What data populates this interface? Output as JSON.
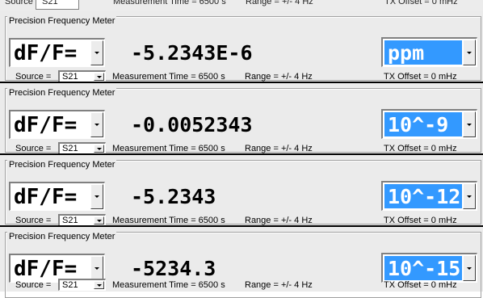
{
  "top_strip": {
    "source_label": "Source =",
    "source_value": "S21",
    "measurement_time": "Measurement Time = 6500 s",
    "range": "Range = +/- 4 Hz",
    "tx_offset": "TX Offset = 0 mHz"
  },
  "panels": [
    {
      "title": "Precision Frequency Meter",
      "mode": "dF/F=",
      "reading": "-5.2343E-6",
      "unit": "ppm",
      "source_label": "Source =",
      "source_value": "S21",
      "measurement_time": "Measurement Time = 6500 s",
      "range": "Range = +/- 4 Hz",
      "tx_offset": "TX Offset = 0 mHz"
    },
    {
      "title": "Precision Frequency Meter",
      "mode": "dF/F=",
      "reading": "-0.0052343",
      "unit": "10^-9",
      "source_label": "Source =",
      "source_value": "S21",
      "measurement_time": "Measurement Time = 6500 s",
      "range": "Range = +/- 4 Hz",
      "tx_offset": "TX Offset = 0 mHz"
    },
    {
      "title": "Precision Frequency Meter",
      "mode": "dF/F=",
      "reading": "-5.2343",
      "unit": "10^-12",
      "source_label": "Source =",
      "source_value": "S21",
      "measurement_time": "Measurement Time = 6500 s",
      "range": "Range = +/- 4 Hz",
      "tx_offset": "TX Offset = 0 mHz"
    },
    {
      "title": "Precision Frequency Meter",
      "mode": "dF/F=",
      "reading": "-5234.3",
      "unit": "10^-15",
      "source_label": "Source =",
      "source_value": "S21",
      "measurement_time": "Measurement Time = 6500 s",
      "range": "Range = +/- 4 Hz",
      "tx_offset": "TX Offset = 0 mHz"
    }
  ],
  "colors": {
    "panel_bg": "#ebebeb",
    "selection": "#3399ff",
    "separator": "#000000"
  },
  "icons": {
    "dropdown": "chevron-down-icon"
  }
}
